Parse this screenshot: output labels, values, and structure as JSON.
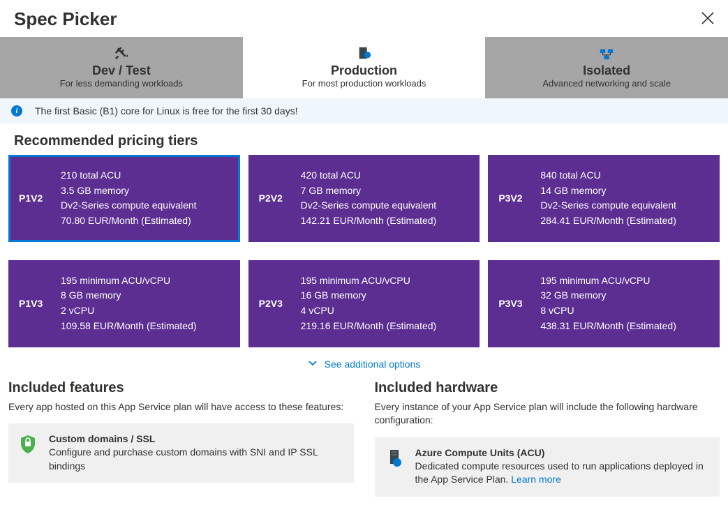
{
  "header": {
    "title": "Spec Picker"
  },
  "tabs": [
    {
      "title": "Dev / Test",
      "sub": "For less demanding workloads"
    },
    {
      "title": "Production",
      "sub": "For most production workloads"
    },
    {
      "title": "Isolated",
      "sub": "Advanced networking and scale"
    }
  ],
  "info_bar": {
    "text": "The first Basic (B1) core for Linux is free for the first 30 days!"
  },
  "recommended_title": "Recommended pricing tiers",
  "tiers": [
    {
      "code": "P1V2",
      "line1": "210 total ACU",
      "line2": "3.5 GB memory",
      "line3": "Dv2-Series compute equivalent",
      "line4": "70.80 EUR/Month (Estimated)",
      "selected": true
    },
    {
      "code": "P2V2",
      "line1": "420 total ACU",
      "line2": "7 GB memory",
      "line3": "Dv2-Series compute equivalent",
      "line4": "142.21 EUR/Month (Estimated)",
      "selected": false
    },
    {
      "code": "P3V2",
      "line1": "840 total ACU",
      "line2": "14 GB memory",
      "line3": "Dv2-Series compute equivalent",
      "line4": "284.41 EUR/Month (Estimated)",
      "selected": false
    },
    {
      "code": "P1V3",
      "line1": "195 minimum ACU/vCPU",
      "line2": "8 GB memory",
      "line3": "2 vCPU",
      "line4": "109.58 EUR/Month (Estimated)",
      "selected": false
    },
    {
      "code": "P2V3",
      "line1": "195 minimum ACU/vCPU",
      "line2": "16 GB memory",
      "line3": "4 vCPU",
      "line4": "219.16 EUR/Month (Estimated)",
      "selected": false
    },
    {
      "code": "P3V3",
      "line1": "195 minimum ACU/vCPU",
      "line2": "32 GB memory",
      "line3": "8 vCPU",
      "line4": "438.31 EUR/Month (Estimated)",
      "selected": false
    }
  ],
  "see_more": "See additional options",
  "features": {
    "title": "Included features",
    "desc": "Every app hosted on this App Service plan will have access to these features:",
    "card": {
      "title": "Custom domains / SSL",
      "desc": "Configure and purchase custom domains with SNI and IP SSL bindings"
    }
  },
  "hardware": {
    "title": "Included hardware",
    "desc": "Every instance of your App Service plan will include the following hardware configuration:",
    "card": {
      "title": "Azure Compute Units (ACU)",
      "desc": "Dedicated compute resources used to run applications deployed in the App Service Plan. ",
      "link": "Learn more"
    }
  }
}
